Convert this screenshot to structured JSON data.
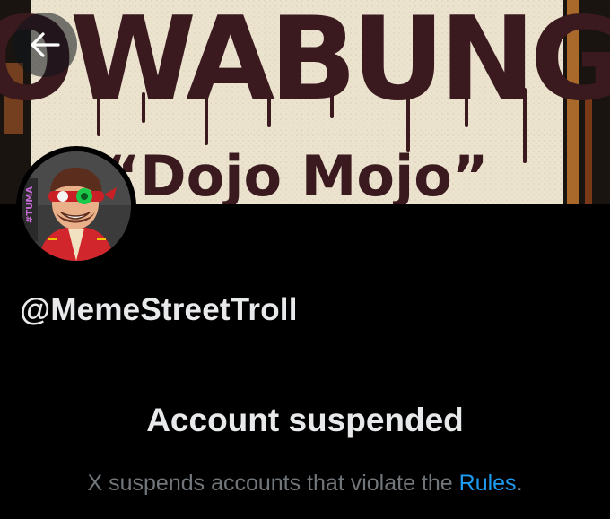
{
  "banner": {
    "headline": "COWABUNGA",
    "subline": "“Dojo Mojo”"
  },
  "profile": {
    "handle": "@MemeStreetTroll",
    "avatar_side_text": "#TUMA"
  },
  "suspension": {
    "title": "Account suspended",
    "message_prefix": "X suspends accounts that violate the ",
    "rules_link": "Rules",
    "message_suffix": "."
  },
  "icons": {
    "back": "arrow-left-icon"
  },
  "colors": {
    "background": "#000000",
    "primary_text": "#e7e9ea",
    "secondary_text": "#71767b",
    "link": "#1d9bf0",
    "banner_paper": "#ece3cf",
    "banner_ink": "#3a1a1f"
  }
}
